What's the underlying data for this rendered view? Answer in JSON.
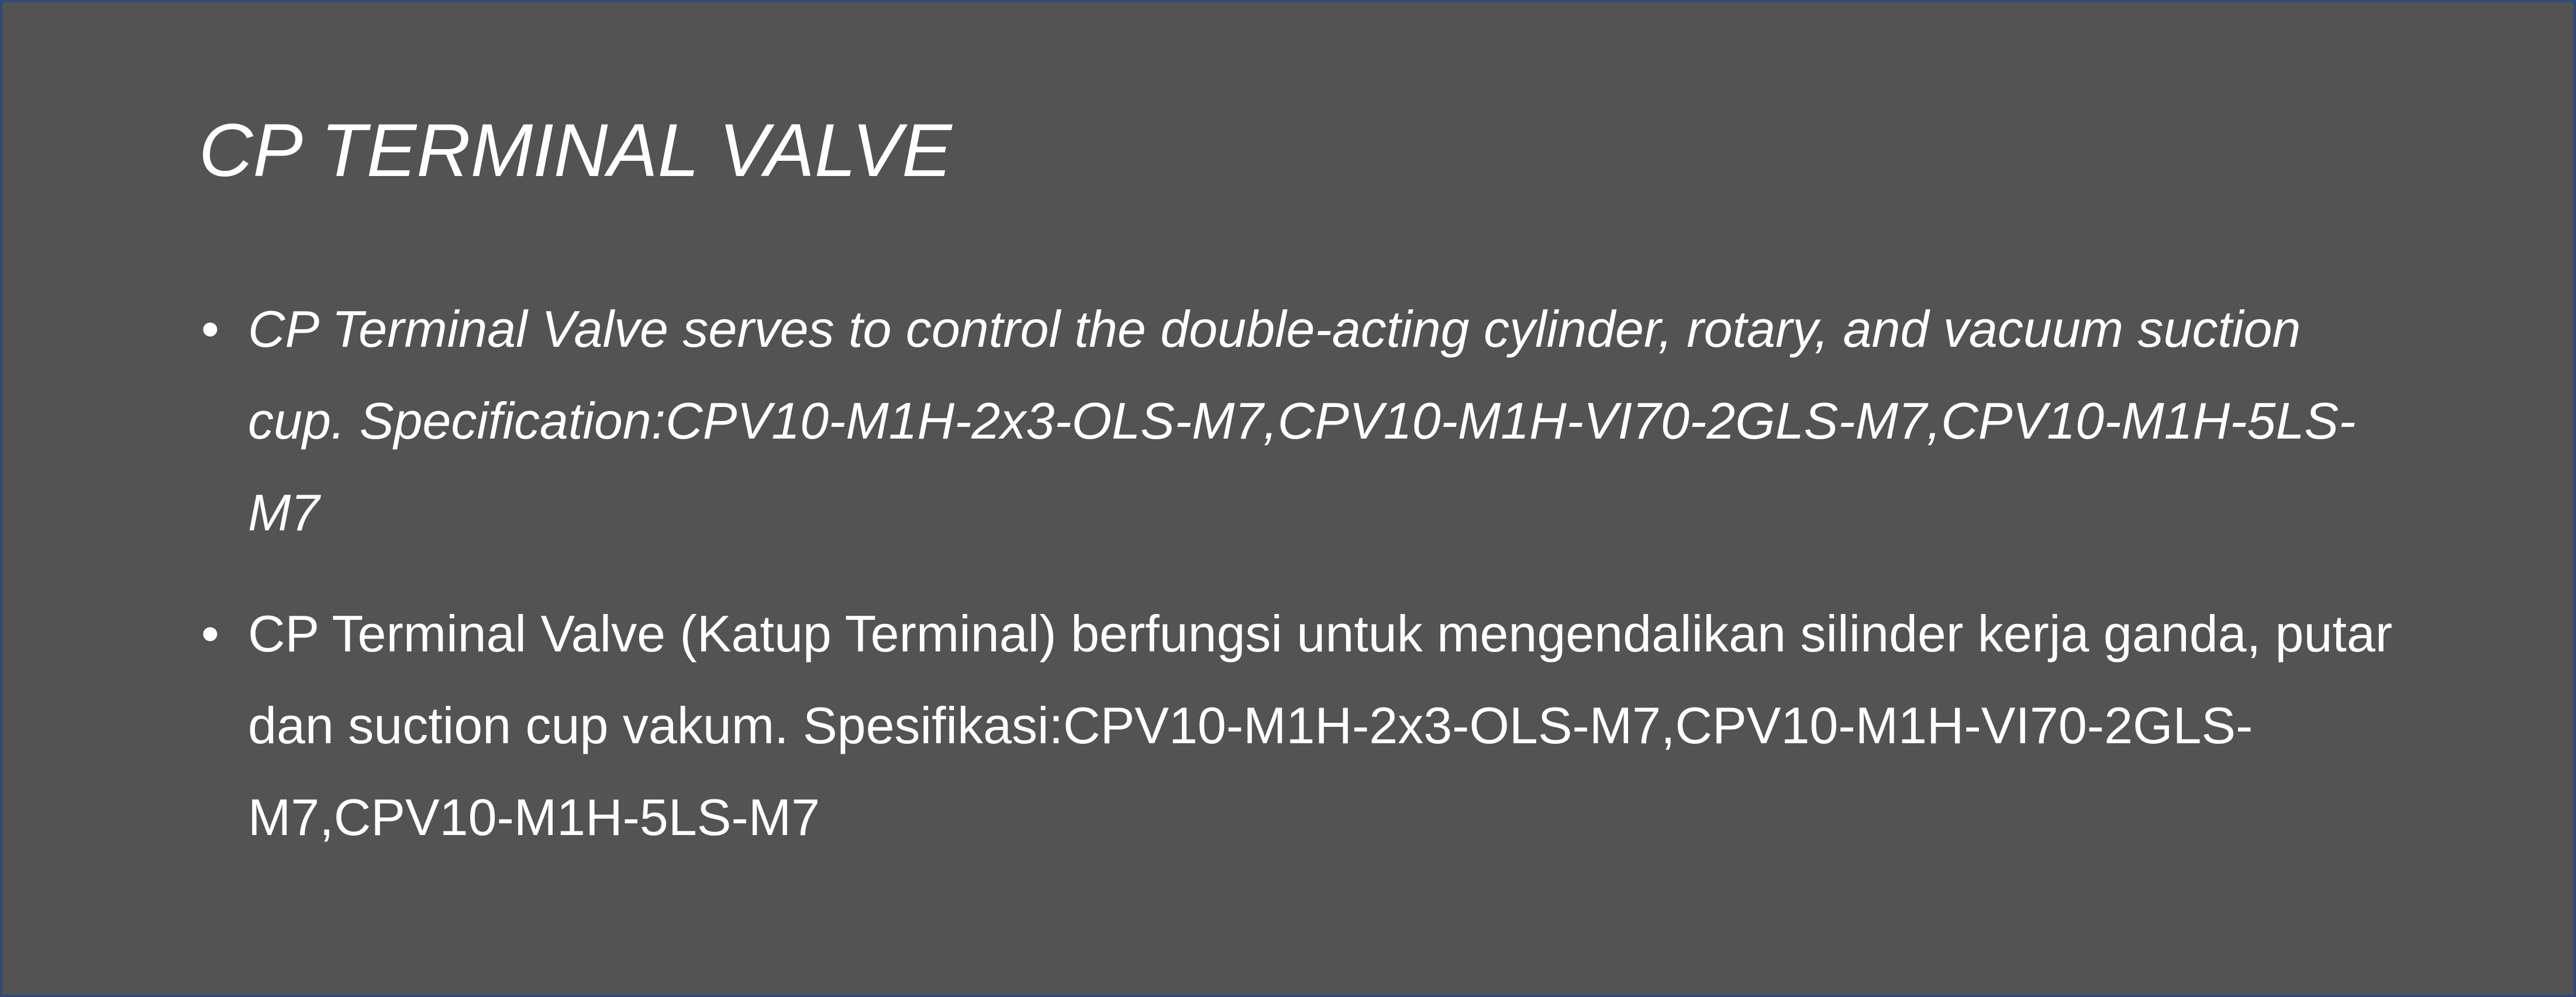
{
  "slide": {
    "title": "CP TERMINAL VALVE",
    "bullets": [
      {
        "marker": "•",
        "text": "CP Terminal Valve serves to control the double-acting cylinder, rotary, and vacuum suction cup. Specification:CPV10-M1H-2x3-OLS-M7,CPV10-M1H-VI70-2GLS-M7,CPV10-M1H-5LS-M7"
      },
      {
        "marker": "•",
        "text": "CP Terminal Valve (Katup Terminal) berfungsi untuk mengendalikan silinder kerja ganda, putar dan suction cup vakum. Spesifikasi:CPV10-M1H-2x3-OLS-M7,CPV10-M1H-VI70-2GLS-M7,CPV10-M1H-5LS-M7"
      }
    ],
    "colors": {
      "background": "#535353",
      "border": "#2f4a7a",
      "text": "#ffffff"
    }
  }
}
